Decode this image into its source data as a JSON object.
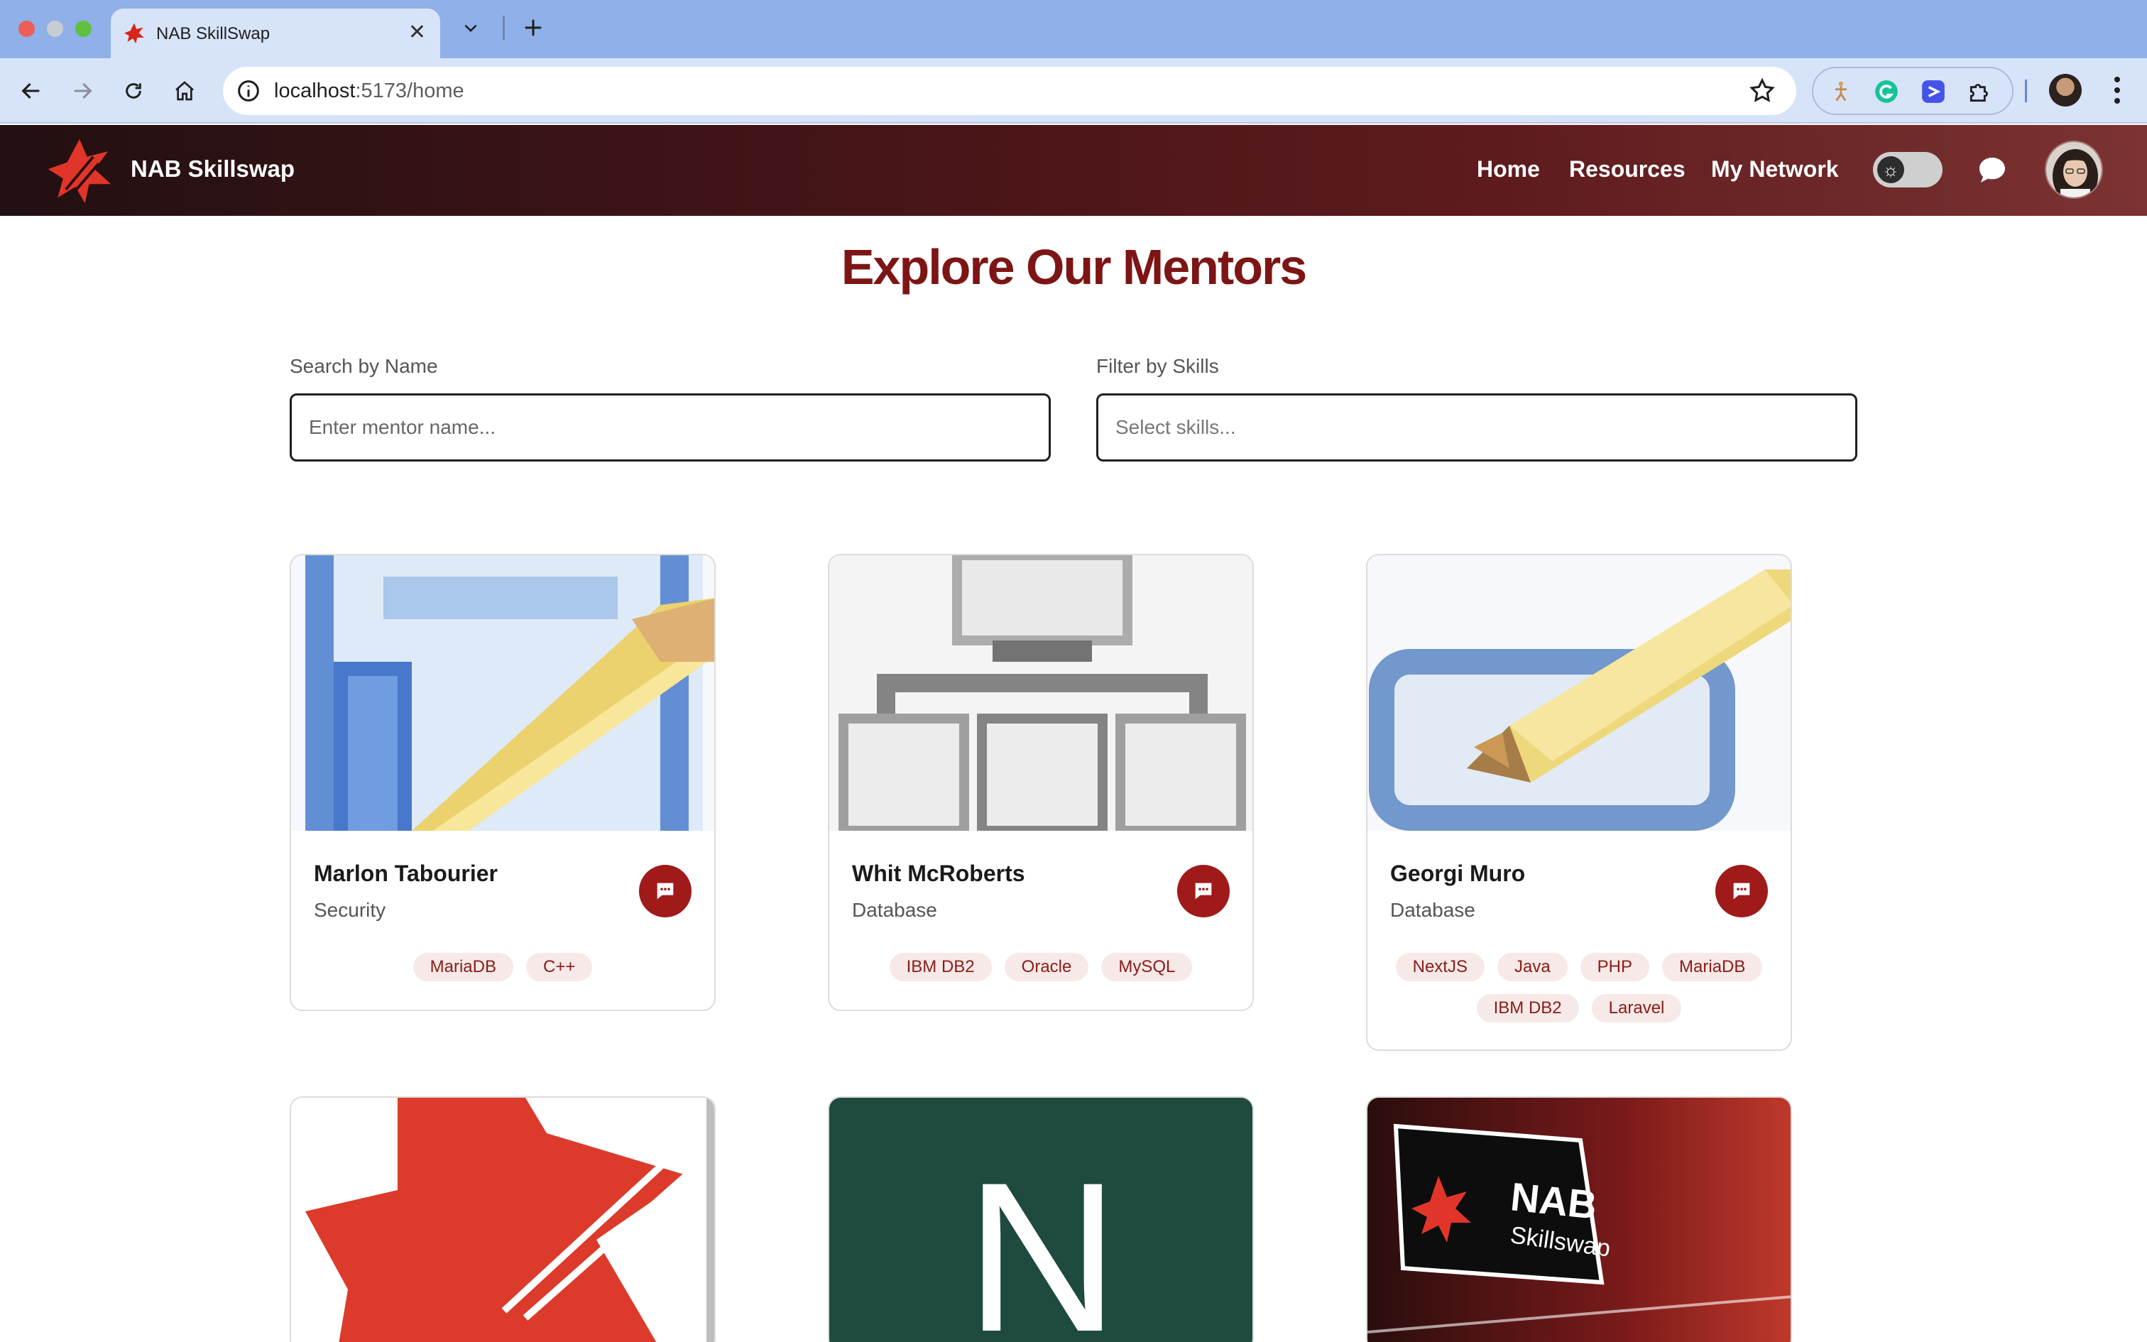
{
  "browser": {
    "tab_title": "NAB SkillSwap",
    "url_host": "localhost",
    "url_path": ":5173/home"
  },
  "app": {
    "brand": "NAB Skillswap",
    "nav": [
      {
        "label": "Home"
      },
      {
        "label": "Resources"
      },
      {
        "label": "My Network"
      }
    ]
  },
  "main": {
    "title": "Explore Our Mentors",
    "search": {
      "label": "Search by Name",
      "placeholder": "Enter mentor name..."
    },
    "filter": {
      "label": "Filter by Skills",
      "placeholder": "Select skills..."
    }
  },
  "mentors": [
    {
      "name": "Marlon Tabourier",
      "role": "Security",
      "skills": [
        "MariaDB",
        "C++"
      ],
      "image": "edit-document-icon"
    },
    {
      "name": "Whit McRoberts",
      "role": "Database",
      "skills": [
        "IBM DB2",
        "Oracle",
        "MySQL"
      ],
      "image": "org-chart-icon"
    },
    {
      "name": "Georgi Muro",
      "role": "Database",
      "skills": [
        "NextJS",
        "Java",
        "PHP",
        "MariaDB",
        "IBM DB2",
        "Laravel"
      ],
      "image": "edit-window-icon"
    },
    {
      "image": "nab-star-logo"
    },
    {
      "image": "letter-n-logo",
      "image_letter": "N"
    },
    {
      "image": "nab-skillswap-sign",
      "sign_brand": "NAB",
      "sign_product": "Skillswap"
    }
  ],
  "colors": {
    "brand_red": "#7d1515",
    "chat_button": "#a01a1a",
    "tag_bg": "#f6e9e7",
    "tag_text": "#8a1c18"
  }
}
